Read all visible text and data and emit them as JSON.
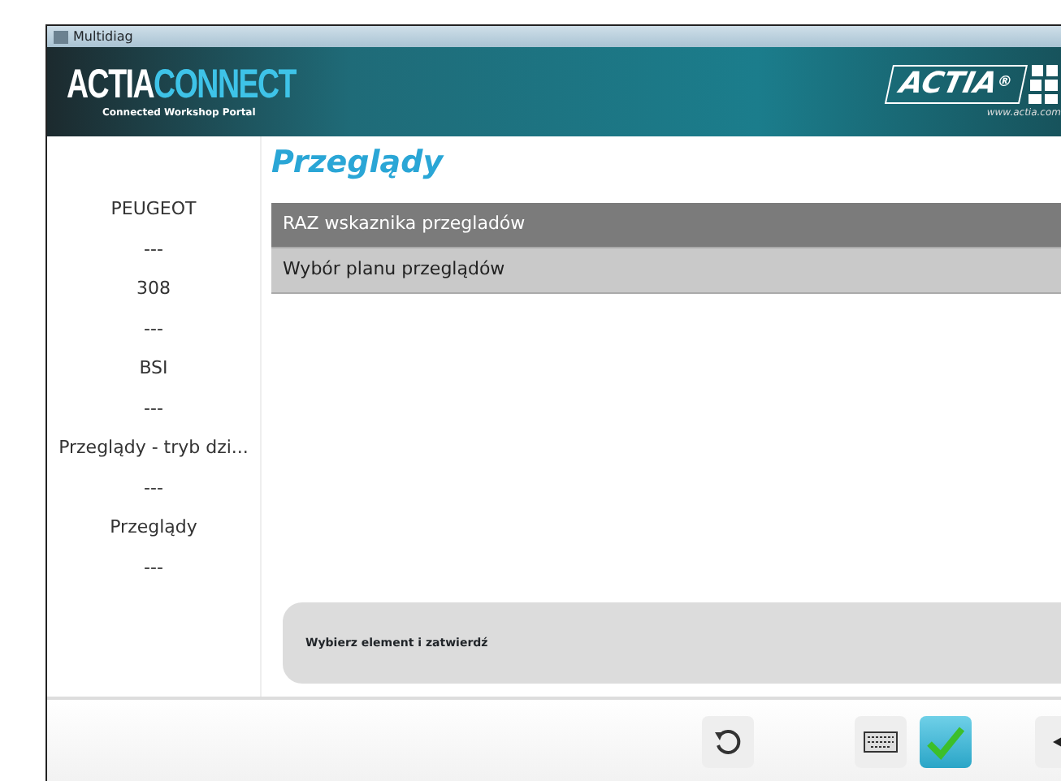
{
  "window": {
    "title": "Multidiag"
  },
  "header": {
    "logo_first": "ACTIA",
    "logo_second": "CONNECT",
    "tagline": "Connected Workshop Portal",
    "brand": "ACTIA",
    "brand_mark": "®",
    "url": "www.actia.com"
  },
  "breadcrumb": [
    "PEUGEOT",
    "---",
    "308",
    "---",
    "BSI",
    "---",
    "Przeglądy - tryb dzi...",
    "---",
    "Przeglądy",
    "---"
  ],
  "page_title": "Przeglądy",
  "menu": [
    {
      "label": "RAZ wskaznika przegladów",
      "selected": true
    },
    {
      "label": "Wybór planu przeglądów",
      "selected": false
    }
  ],
  "message": "Wybierz element i zatwierdź",
  "toolbar": [
    {
      "kind": "refresh",
      "highlighted": false
    },
    {
      "kind": "keyboard",
      "highlighted": false
    },
    {
      "kind": "confirm",
      "highlighted": true
    },
    {
      "kind": "back",
      "highlighted": false
    }
  ]
}
